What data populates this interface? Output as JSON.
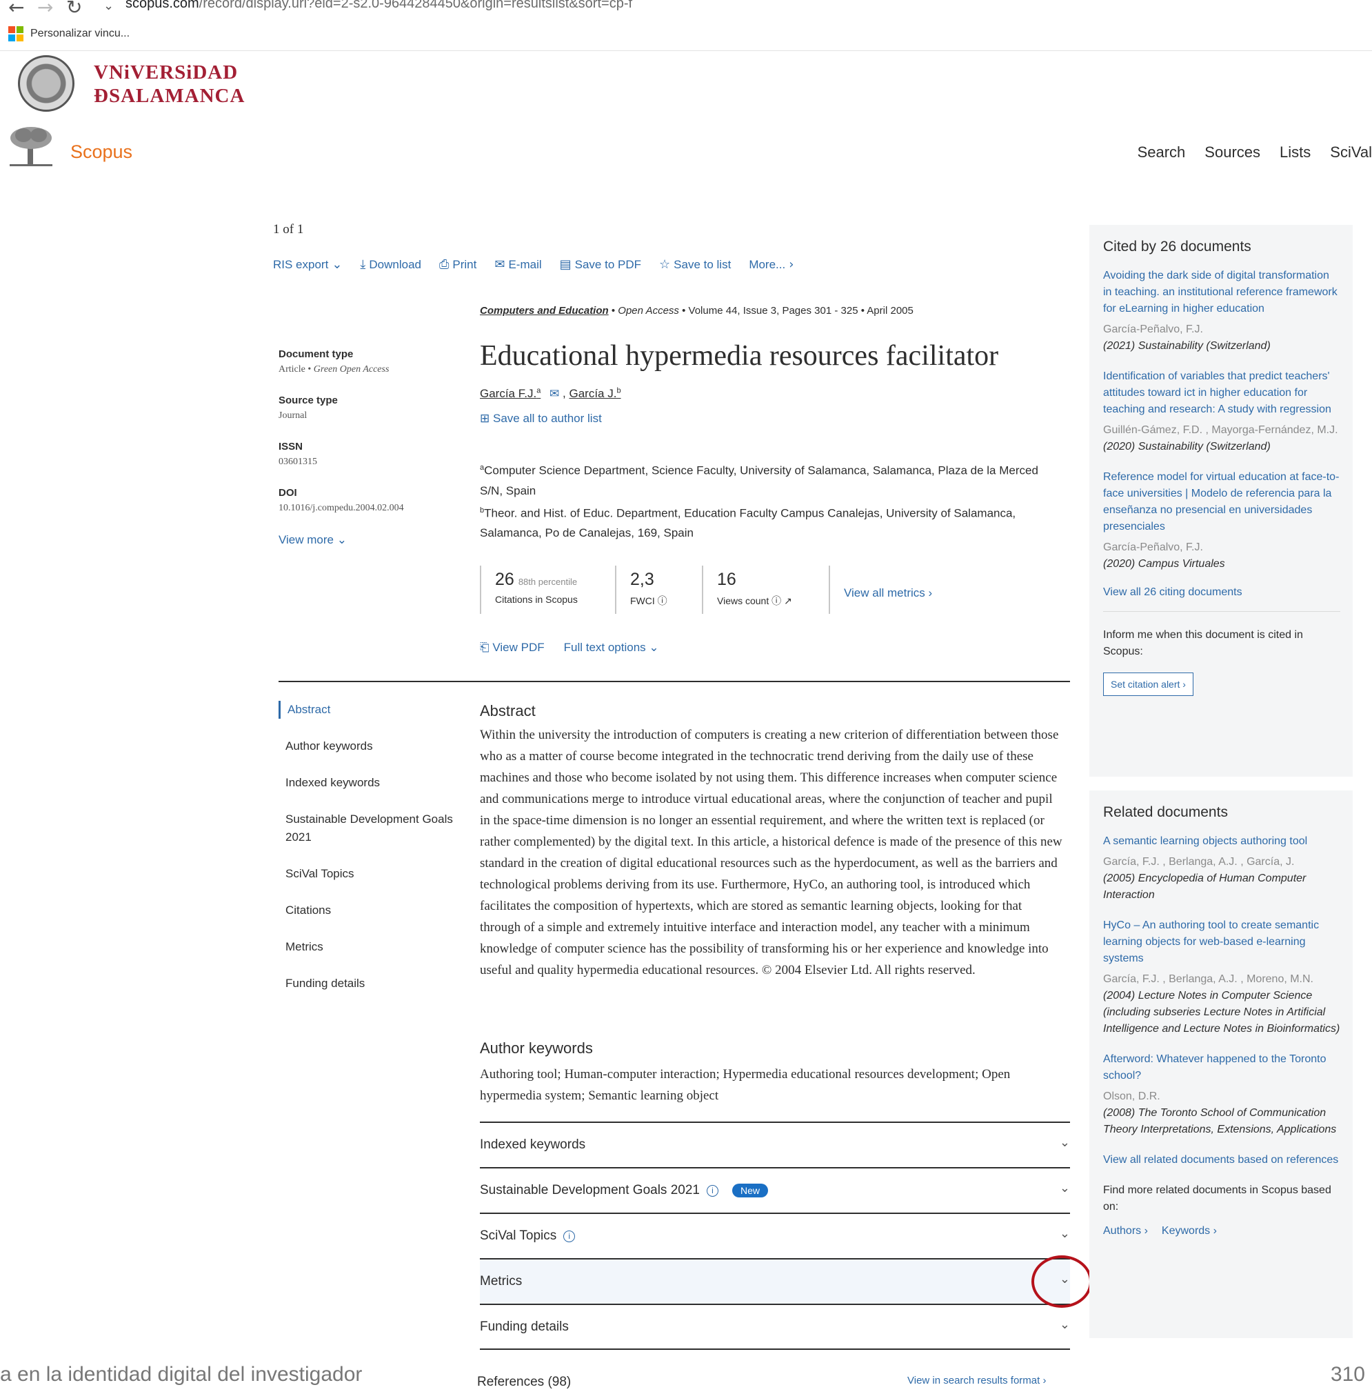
{
  "browser": {
    "url_host": "scopus.com",
    "url_rest": "/record/display.uri?eid=2-s2.0-9644284450&origin=resultslist&sort=cp-f",
    "bookmark": "Personalizar vincu..."
  },
  "university": {
    "line1": "VNiVERSiDAD",
    "line2": "ÐSALAMANCA"
  },
  "scopus": {
    "logo": "Scopus",
    "nav": [
      "Search",
      "Sources",
      "Lists",
      "SciVal"
    ]
  },
  "record": {
    "pager": "1 of 1",
    "toolbar": {
      "ris": "RIS export",
      "download": "Download",
      "print": "Print",
      "email": "E-mail",
      "save_pdf": "Save to PDF",
      "save_list": "Save to list",
      "more": "More..."
    },
    "meta": {
      "doctype_label": "Document type",
      "doctype_value": "Article",
      "doctype_oa": "Green Open Access",
      "source_label": "Source type",
      "source_value": "Journal",
      "issn_label": "ISSN",
      "issn_value": "03601315",
      "doi_label": "DOI",
      "doi_value": "10.1016/j.compedu.2004.02.004",
      "view_more": "View more"
    },
    "source": {
      "journal": "Computers and Education",
      "oa": "Open Access",
      "volume": "Volume 44, Issue 3, Pages 301 - 325",
      "date": "April 2005"
    },
    "title": "Educational hypermedia resources facilitator",
    "authors": [
      {
        "name": "García F.J.",
        "sup": "a"
      },
      {
        "name": "García J.",
        "sup": "b"
      }
    ],
    "save_all": "Save all to author list",
    "affiliations": [
      {
        "sup": "a",
        "text": "Computer Science Department, Science Faculty, University of Salamanca, Salamanca, Plaza de la Merced S/N, Spain"
      },
      {
        "sup": "b",
        "text": "Theor. and Hist. of Educ. Department, Education Faculty Campus Canalejas, University of Salamanca, Salamanca, Po de Canalejas, 169, Spain"
      }
    ],
    "metrics": {
      "citations": "26",
      "percentile": "88th percentile",
      "citations_label": "Citations in Scopus",
      "fwci": "2,3",
      "fwci_label": "FWCI",
      "views": "16",
      "views_label": "Views count",
      "view_all": "View all metrics"
    },
    "view_pdf": "View PDF",
    "full_text": "Full text options",
    "section_nav": [
      "Abstract",
      "Author keywords",
      "Indexed keywords",
      "Sustainable Development Goals 2021",
      "SciVal Topics",
      "Citations",
      "Metrics",
      "Funding details"
    ],
    "abstract_heading": "Abstract",
    "abstract": "Within the university the introduction of computers is creating a new criterion of differentiation between those who as a matter of course become integrated in the technocratic trend deriving from the daily use of these machines and those who become isolated by not using them. This difference increases when computer science and communications merge to introduce virtual educational areas, where the conjunction of teacher and pupil in the space-time dimension is no longer an essential requirement, and where the written text is replaced (or rather complemented) by the digital text. In this article, a historical defence is made of the presence of this new standard in the creation of digital educational resources such as the hyperdocument, as well as the barriers and technological problems deriving from its use. Furthermore, HyCo, an authoring tool, is introduced which facilitates the composition of hypertexts, which are stored as semantic learning objects, looking for that through of a simple and extremely intuitive interface and interaction model, any teacher with a minimum knowledge of computer science has the possibility of transforming his or her experience and knowledge into useful and quality hypermedia educational resources. © 2004 Elsevier Ltd. All rights reserved.",
    "keywords_heading": "Author keywords",
    "keywords": "Authoring tool;   Human-computer interaction;   Hypermedia educational resources development;   Open hypermedia system;   Semantic learning object",
    "accordions": {
      "indexed": "Indexed keywords",
      "sdg": "Sustainable Development Goals 2021",
      "sdg_badge": "New",
      "scival": "SciVal Topics",
      "metrics": "Metrics",
      "funding": "Funding details"
    },
    "references": "References (98)",
    "references_link": "View in search results format"
  },
  "cited_by": {
    "heading": "Cited by 26 documents",
    "items": [
      {
        "title": "Avoiding the dark side of digital transformation in teaching. an institutional reference framework for eLearning in higher education",
        "authors": "García-Peñalvo, F.J.",
        "journal": "(2021) Sustainability (Switzerland)"
      },
      {
        "title": "Identification of variables that predict teachers' attitudes toward ict in higher education for teaching and research: A study with regression",
        "authors": "Guillén-Gámez, F.D. , Mayorga-Fernández, M.J.",
        "journal": "(2020) Sustainability (Switzerland)"
      },
      {
        "title": "Reference model for virtual education at face-to-face universities | Modelo de referencia para la enseñanza no presencial en universidades presenciales",
        "authors": "García-Peñalvo, F.J.",
        "journal": "(2020) Campus Virtuales"
      }
    ],
    "view_all": "View all 26 citing documents",
    "inform": "Inform me when this document is cited in Scopus:",
    "alert_btn": "Set citation alert"
  },
  "related": {
    "heading": "Related documents",
    "items": [
      {
        "title": "A semantic learning objects authoring tool",
        "authors": "García, F.J. , Berlanga, A.J. , García, J.",
        "journal": "(2005) Encyclopedia of Human Computer Interaction"
      },
      {
        "title": "HyCo – An authoring tool to create semantic learning objects for web-based e-learning systems",
        "authors": "García, F.J. , Berlanga, A.J. , Moreno, M.N.",
        "journal": "(2004) Lecture Notes in Computer Science (including subseries Lecture Notes in Artificial Intelligence and Lecture Notes in Bioinformatics)"
      },
      {
        "title": "Afterword: Whatever happened to the Toronto school?",
        "authors": "Olson, D.R.",
        "journal": "(2008) The Toronto School of Communication Theory Interpretations, Extensions, Applications"
      }
    ],
    "view_all": "View all related documents based on references",
    "find_more": "Find more related documents in Scopus based on:",
    "authors_link": "Authors",
    "keywords_link": "Keywords"
  },
  "footer": {
    "left": "a en la identidad digital del investigador",
    "right": "310"
  },
  "colors": {
    "link": "#2e6aa8",
    "brand": "#e9711c",
    "university": "#a31f34",
    "annotation": "#b5121b"
  }
}
